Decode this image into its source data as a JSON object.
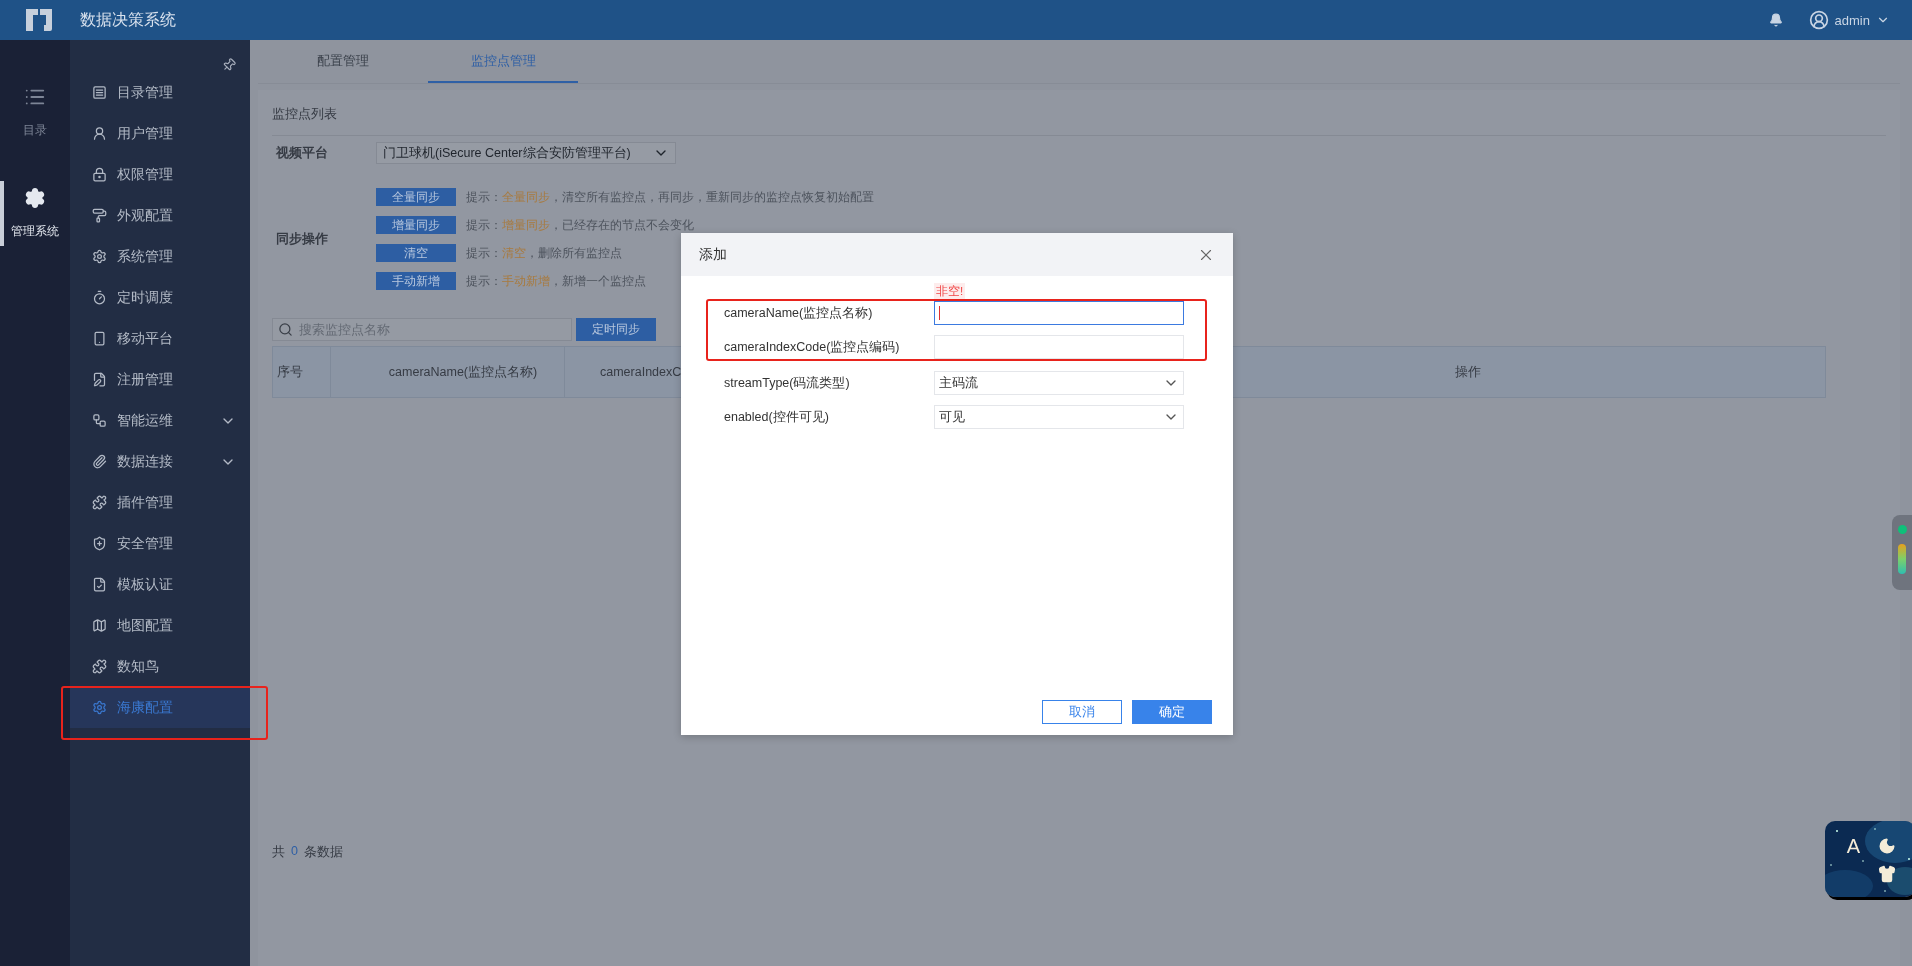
{
  "top_bar": {
    "title": "数据决策系统",
    "user": "admin"
  },
  "rail": [
    {
      "label": "目录",
      "selected": false
    },
    {
      "label": "管理系统",
      "selected": true
    }
  ],
  "menu": [
    {
      "label": "目录管理",
      "selected": false,
      "expandable": false,
      "annotated": false
    },
    {
      "label": "用户管理",
      "selected": false,
      "expandable": false,
      "annotated": false
    },
    {
      "label": "权限管理",
      "selected": false,
      "expandable": false,
      "annotated": false
    },
    {
      "label": "外观配置",
      "selected": false,
      "expandable": false,
      "annotated": false
    },
    {
      "label": "系统管理",
      "selected": false,
      "expandable": false,
      "annotated": false
    },
    {
      "label": "定时调度",
      "selected": false,
      "expandable": false,
      "annotated": false
    },
    {
      "label": "移动平台",
      "selected": false,
      "expandable": false,
      "annotated": false
    },
    {
      "label": "注册管理",
      "selected": false,
      "expandable": false,
      "annotated": false
    },
    {
      "label": "智能运维",
      "selected": false,
      "expandable": true,
      "annotated": false
    },
    {
      "label": "数据连接",
      "selected": false,
      "expandable": true,
      "annotated": false
    },
    {
      "label": "插件管理",
      "selected": false,
      "expandable": false,
      "annotated": false
    },
    {
      "label": "安全管理",
      "selected": false,
      "expandable": false,
      "annotated": false
    },
    {
      "label": "模板认证",
      "selected": false,
      "expandable": false,
      "annotated": false
    },
    {
      "label": "地图配置",
      "selected": false,
      "expandable": false,
      "annotated": false
    },
    {
      "label": "数知鸟",
      "selected": false,
      "expandable": false,
      "annotated": false
    },
    {
      "label": "海康配置",
      "selected": true,
      "expandable": false,
      "annotated": true
    }
  ],
  "tabs": [
    {
      "label": "配置管理",
      "selected": false
    },
    {
      "label": "监控点管理",
      "selected": true
    }
  ],
  "panel": {
    "title": "监控点列表",
    "platform": {
      "label": "视频平台",
      "value": "门卫球机(iSecure Center综合安防管理平台)"
    },
    "sync": {
      "label": "同步操作",
      "actions": [
        {
          "button": "全量同步",
          "prefix": "提示：",
          "highlight": "全量同步",
          "rest": "，清空所有监控点，再同步，重新同步的监控点恢复初始配置"
        },
        {
          "button": "增量同步",
          "prefix": "提示：",
          "highlight": "增量同步",
          "rest": "，已经存在的节点不会变化"
        },
        {
          "button": "清空",
          "prefix": "提示：",
          "highlight": "清空",
          "rest": "，删除所有监控点"
        },
        {
          "button": "手动新增",
          "prefix": "提示：",
          "highlight": "手动新增",
          "rest": "，新增一个监控点"
        }
      ]
    },
    "search": {
      "placeholder": "搜索监控点名称"
    },
    "schedule_button": "定时同步",
    "table": {
      "columns": [
        "序号",
        "cameraName(监控点名称)",
        "cameraIndexC",
        "操作"
      ]
    },
    "footer": {
      "prefix": "共",
      "count": "0",
      "suffix": "条数据"
    }
  },
  "dialog": {
    "title": "添加",
    "fields": [
      {
        "label": "cameraName(监控点名称)",
        "kind": "text",
        "focused": true,
        "error": "非空!",
        "annotated": true
      },
      {
        "label": "cameraIndexCode(监控点编码)",
        "kind": "text",
        "focused": false,
        "annotated": true
      },
      {
        "label": "streamType(码流类型)",
        "kind": "select",
        "value": "主码流",
        "focused": false,
        "annotated": false
      },
      {
        "label": "enabled(控件可见)",
        "kind": "select",
        "value": "可见",
        "focused": false,
        "annotated": false
      }
    ],
    "buttons": [
      {
        "label": "取消",
        "kind": "secondary"
      },
      {
        "label": "确定",
        "kind": "primary"
      }
    ]
  },
  "theme_widget": {
    "letter": "A"
  }
}
